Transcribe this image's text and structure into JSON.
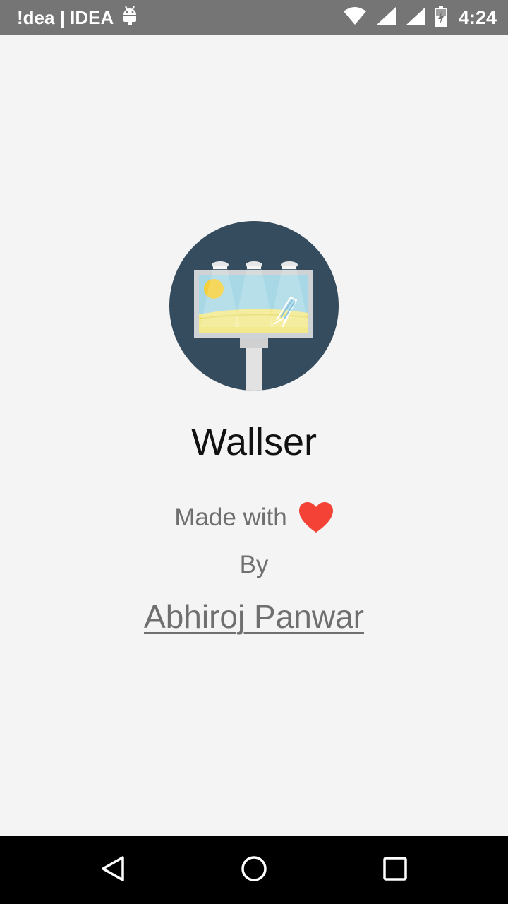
{
  "status_bar": {
    "carrier": "!dea | IDEA",
    "time": "4:24",
    "icons": [
      "android-icon",
      "wifi-icon",
      "signal-icon",
      "signal-icon",
      "battery-charging-icon"
    ]
  },
  "app": {
    "name": "Wallser",
    "made_with": "Made with",
    "heart_color": "#f44336",
    "by": "By",
    "author": "Abhiroj Panwar",
    "logo_icon": "billboard-beach-icon",
    "logo_bg_color": "#354c5e"
  },
  "nav": {
    "icons": [
      "back-icon",
      "home-icon",
      "recents-icon"
    ]
  }
}
